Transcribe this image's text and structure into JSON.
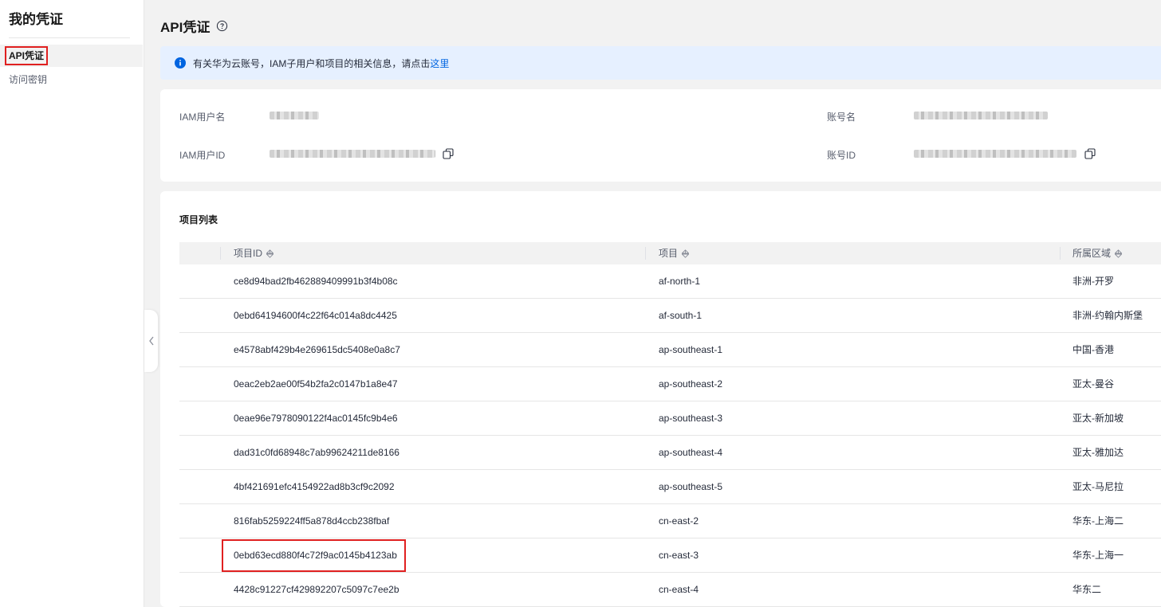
{
  "sidebar": {
    "title": "我的凭证",
    "items": [
      {
        "label": "API凭证",
        "active": true
      },
      {
        "label": "访问密钥",
        "active": false
      }
    ]
  },
  "page": {
    "title": "API凭证"
  },
  "banner": {
    "text": "有关华为云账号，IAM子用户和项目的相关信息，请点击",
    "link": "这里",
    "color": "#e6f0ff"
  },
  "user_info": {
    "iam_username_label": "IAM用户名",
    "iam_userid_label": "IAM用户ID",
    "account_name_label": "账号名",
    "account_id_label": "账号ID"
  },
  "projects": {
    "title": "项目列表",
    "columns": [
      "项目ID",
      "项目",
      "所属区域"
    ],
    "rows": [
      {
        "id": "ce8d94bad2fb462889409991b3f4b08c",
        "project": "af-north-1",
        "region": "非洲-开罗"
      },
      {
        "id": "0ebd64194600f4c22f64c014a8dc4425",
        "project": "af-south-1",
        "region": "非洲-约翰内斯堡"
      },
      {
        "id": "e4578abf429b4e269615dc5408e0a8c7",
        "project": "ap-southeast-1",
        "region": "中国-香港"
      },
      {
        "id": "0eac2eb2ae00f54b2fa2c0147b1a8e47",
        "project": "ap-southeast-2",
        "region": "亚太-曼谷"
      },
      {
        "id": "0eae96e7978090122f4ac0145fc9b4e6",
        "project": "ap-southeast-3",
        "region": "亚太-新加坡"
      },
      {
        "id": "dad31c0fd68948c7ab99624211de8166",
        "project": "ap-southeast-4",
        "region": "亚太-雅加达"
      },
      {
        "id": "4bf421691efc4154922ad8b3cf9c2092",
        "project": "ap-southeast-5",
        "region": "亚太-马尼拉"
      },
      {
        "id": "816fab5259224ff5a878d4ccb238fbaf",
        "project": "cn-east-2",
        "region": "华东-上海二"
      },
      {
        "id": "0ebd63ecd880f4c72f9ac0145b4123ab",
        "project": "cn-east-3",
        "region": "华东-上海一",
        "highlighted": true
      },
      {
        "id": "4428c91227cf429892207c5097c7ee2b",
        "project": "cn-east-4",
        "region": "华东二"
      }
    ]
  },
  "colors": {
    "accent": "#0064e0",
    "highlight": "#e02020"
  },
  "icons": {
    "help": "help-circle-icon",
    "info": "info-icon",
    "copy": "copy-icon",
    "sort": "sort-icon",
    "collapse": "chevron-left-icon"
  }
}
